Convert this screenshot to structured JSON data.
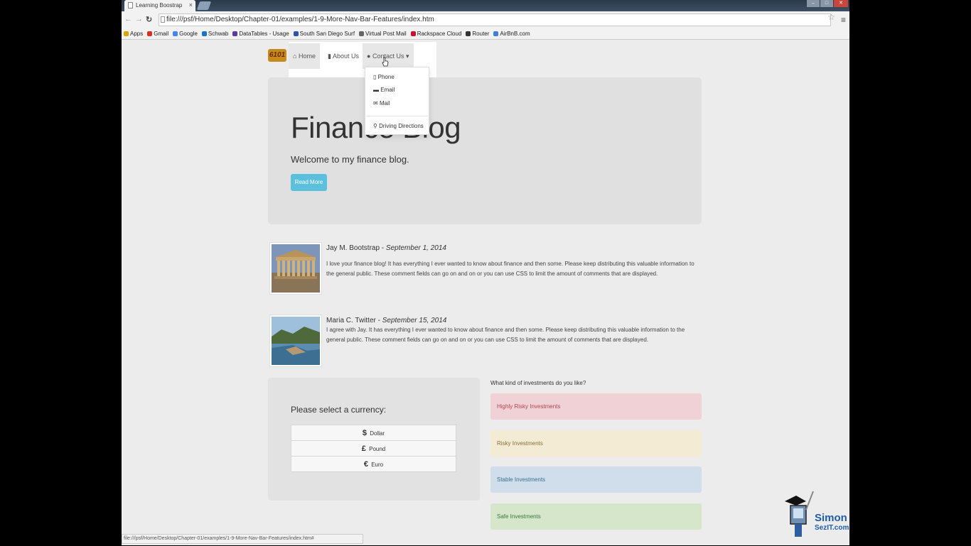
{
  "browser": {
    "tab_title": "Learning Boostrap",
    "tab_close": "×",
    "url": "file:///psf/Home/Desktop/Chapter-01/examples/1-9-More-Nav-Bar-Features/index.htm",
    "status_url": "file:///psf/Home/Desktop/Chapter-01/examples/1-9-More-Nav-Bar-Features/index.htm#"
  },
  "bookmarks": [
    {
      "label": "Apps",
      "icon": "apps-grid-icon",
      "color": "#d9a300"
    },
    {
      "label": "Gmail",
      "icon": "gmail-icon",
      "color": "#d93025"
    },
    {
      "label": "Google",
      "icon": "google-icon",
      "color": "#4285f4"
    },
    {
      "label": "Schwab",
      "icon": "schwab-icon",
      "color": "#1a73c9"
    },
    {
      "label": "DataTables - Usage",
      "icon": "datatables-icon",
      "color": "#5b3aa0"
    },
    {
      "label": "South San Diego Surf",
      "icon": "surf-icon",
      "color": "#2b56a8"
    },
    {
      "label": "Virtual Post Mail",
      "icon": "mail-icon",
      "color": "#666666"
    },
    {
      "label": "Rackspace Cloud",
      "icon": "rackspace-icon",
      "color": "#c8102e"
    },
    {
      "label": "Router",
      "icon": "router-icon",
      "color": "#333333"
    },
    {
      "label": "AirBnB.com",
      "icon": "airbnb-icon",
      "color": "#3f7fd8"
    }
  ],
  "navbar": {
    "brand": "6101",
    "home": "Home",
    "about": "About Us",
    "contact": "Contact Us"
  },
  "dropdown": {
    "phone": "Phone",
    "email": "Email",
    "mail": "Mail",
    "directions": "Driving Directions"
  },
  "jumbotron": {
    "title": "Finance Blog",
    "subtitle": "Welcome to my finance blog.",
    "button": "Read More"
  },
  "comments": [
    {
      "author": "Jay M. Bootstrap - ",
      "date": "September 1, 2014",
      "text": "I love your finance blog! It has everything I ever wanted to know about finance and then some. Please keep distributing this valuable information to the general public. These comment fields can go on and on or you can use CSS to limit the amount of comments that are displayed."
    },
    {
      "author": "Maria C. Twitter - ",
      "date": "September 15, 2014",
      "text": "I agree with Jay. It has everything I ever wanted to know about finance and then some. Please keep distributing this valuable information to the general public. These comment fields can go on and on or you can use CSS to limit the amount of comments that are displayed."
    }
  ],
  "currency": {
    "heading": "Please select a currency:",
    "options": [
      {
        "symbol": "$",
        "label": "Dollar"
      },
      {
        "symbol": "£",
        "label": "Pound"
      },
      {
        "symbol": "€",
        "label": "Euro"
      }
    ]
  },
  "investments": {
    "question": "What kind of investments do you like?",
    "items": [
      {
        "label": "Highly Risky Investments",
        "bg": "#f0d2d6",
        "color": "#b5434e"
      },
      {
        "label": "Risky Investments",
        "bg": "#f3ebd3",
        "color": "#8a6d3b"
      },
      {
        "label": "Stable Investments",
        "bg": "#cfdeea",
        "color": "#3a6f93"
      },
      {
        "label": "Safe Investments",
        "bg": "#d5e6cb",
        "color": "#3c763d"
      }
    ]
  },
  "watermark": {
    "line1": "Simon",
    "line2": "SezIT.com"
  }
}
